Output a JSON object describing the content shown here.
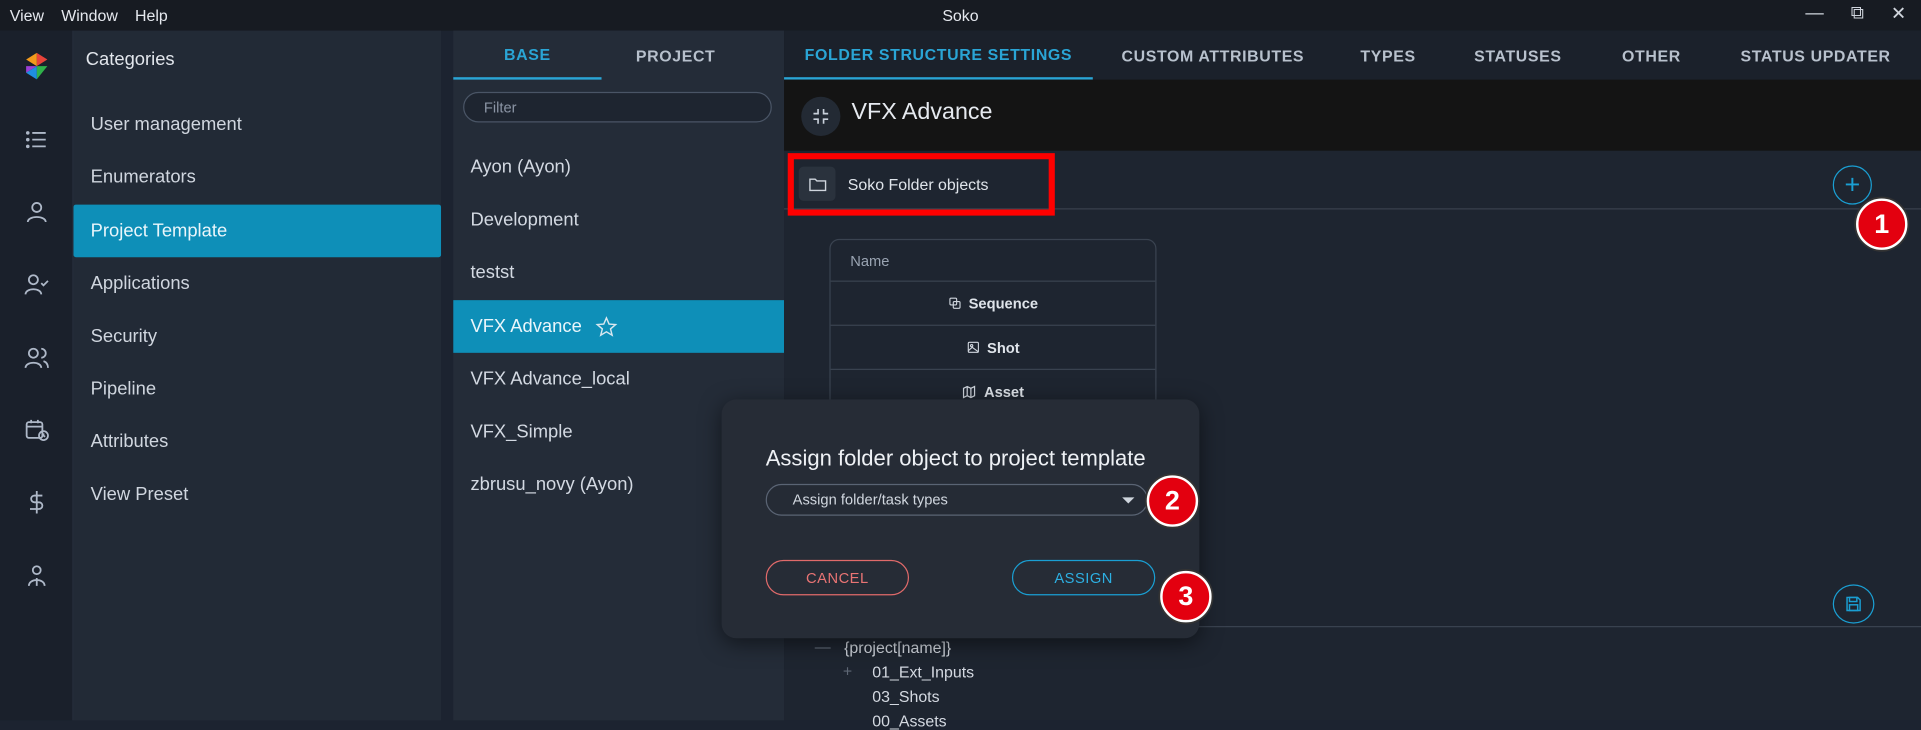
{
  "window": {
    "title": "Soko",
    "menu": [
      "View",
      "Window",
      "Help"
    ],
    "controls": [
      "minimize-icon",
      "restore-icon",
      "close-icon"
    ]
  },
  "rail": {
    "icons": [
      "soko-logo",
      "list-icon",
      "user-icon",
      "user-check-icon",
      "users-icon",
      "calendar-clock-icon",
      "dollar-icon",
      "user-group-icon"
    ]
  },
  "categories": {
    "title": "Categories",
    "items": [
      {
        "label": "User management"
      },
      {
        "label": "Enumerators"
      },
      {
        "label": "Project Template"
      },
      {
        "label": "Applications"
      },
      {
        "label": "Security"
      },
      {
        "label": "Pipeline"
      },
      {
        "label": "Attributes"
      },
      {
        "label": "View Preset"
      }
    ],
    "active_index": 2
  },
  "templates": {
    "tabs": [
      "BASE",
      "PROJECT"
    ],
    "active_tab": 0,
    "filter_placeholder": "Filter",
    "items": [
      {
        "label": "Ayon (Ayon)"
      },
      {
        "label": "Development"
      },
      {
        "label": "testst"
      },
      {
        "label": "VFX Advance"
      },
      {
        "label": "VFX Advance_local"
      },
      {
        "label": "VFX_Simple"
      },
      {
        "label": "zbrusu_novy (Ayon)"
      }
    ],
    "active_index": 3
  },
  "main": {
    "tabs": [
      "FOLDER STRUCTURE SETTINGS",
      "CUSTOM ATTRIBUTES",
      "TYPES",
      "STATUSES",
      "OTHER",
      "STATUS UPDATER"
    ],
    "active_tab": 0,
    "header_title": "VFX Advance",
    "folder_objects_label": "Soko Folder objects",
    "table": {
      "header": "Name",
      "rows": [
        {
          "label": "Sequence",
          "icon": "sequence-icon"
        },
        {
          "label": "Shot",
          "icon": "image-icon"
        },
        {
          "label": "Asset",
          "icon": "asset-icon"
        }
      ]
    },
    "tree": {
      "root": "{project[name]}",
      "children": [
        "01_Ext_Inputs",
        "03_Shots",
        "00_Assets"
      ]
    }
  },
  "dialog": {
    "title": "Assign folder object to project template",
    "select_placeholder": "Assign folder/task types",
    "cancel_label": "CANCEL",
    "assign_label": "ASSIGN"
  },
  "annotations": {
    "badge1": "1",
    "badge2": "2",
    "badge3": "3",
    "color": "#e3000f"
  },
  "colors": {
    "accent": "#0e8fb8",
    "accent_text": "#2aa5d5",
    "danger": "#e06a6a",
    "highlight_box": "#ff0000"
  }
}
